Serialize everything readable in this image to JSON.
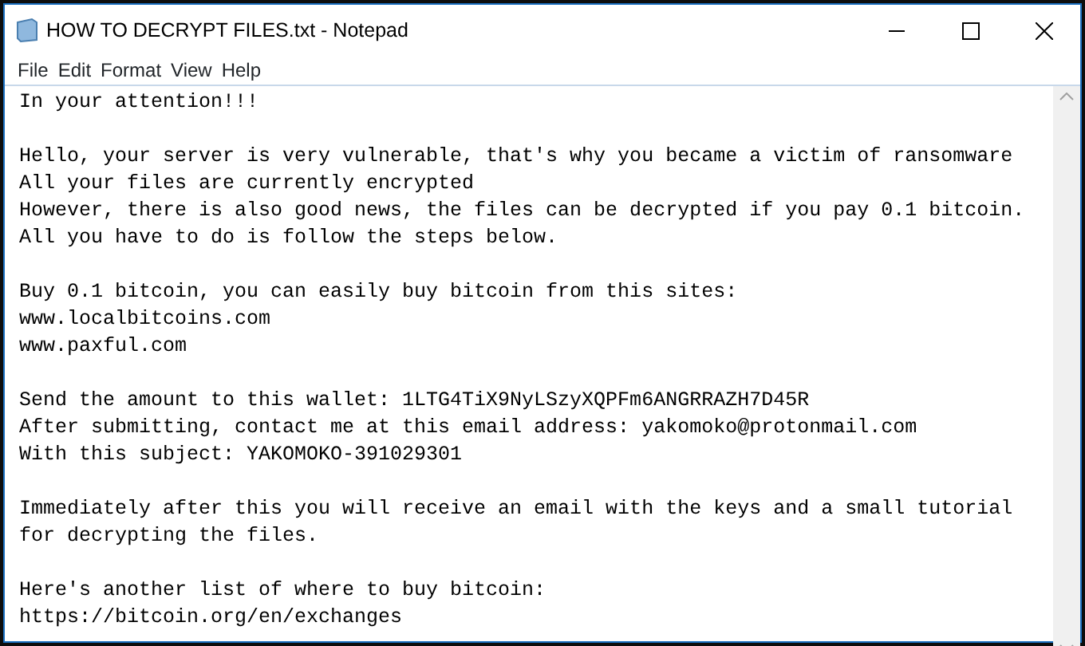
{
  "window": {
    "title": "HOW TO DECRYPT FILES.txt - Notepad"
  },
  "menu": [
    "File",
    "Edit",
    "Format",
    "View",
    "Help"
  ],
  "document": {
    "paragraphs": [
      [
        "In your attention!!!"
      ],
      [
        "Hello, your server is very vulnerable, that's why you became a victim of ransomware",
        "All your files are currently encrypted",
        "However, there is also good news, the files can be decrypted if you pay 0.1 bitcoin.",
        "All you have to do is follow the steps below."
      ],
      [
        "Buy 0.1 bitcoin, you can easily buy bitcoin from this sites:",
        "www.localbitcoins.com",
        "www.paxful.com"
      ],
      [
        "Send the amount to this wallet: 1LTG4TiX9NyLSzyXQPFm6ANGRRAZH7D45R",
        "After submitting, contact me at this email address: yakomoko@protonmail.com",
        "With this subject: YAKOMOKO-391029301"
      ],
      [
        "Immediately after this you will receive an email with the keys and a small tutorial",
        "for decrypting the files."
      ],
      [
        "Here's another list of where to buy bitcoin:",
        "https://bitcoin.org/en/exchanges"
      ]
    ]
  }
}
